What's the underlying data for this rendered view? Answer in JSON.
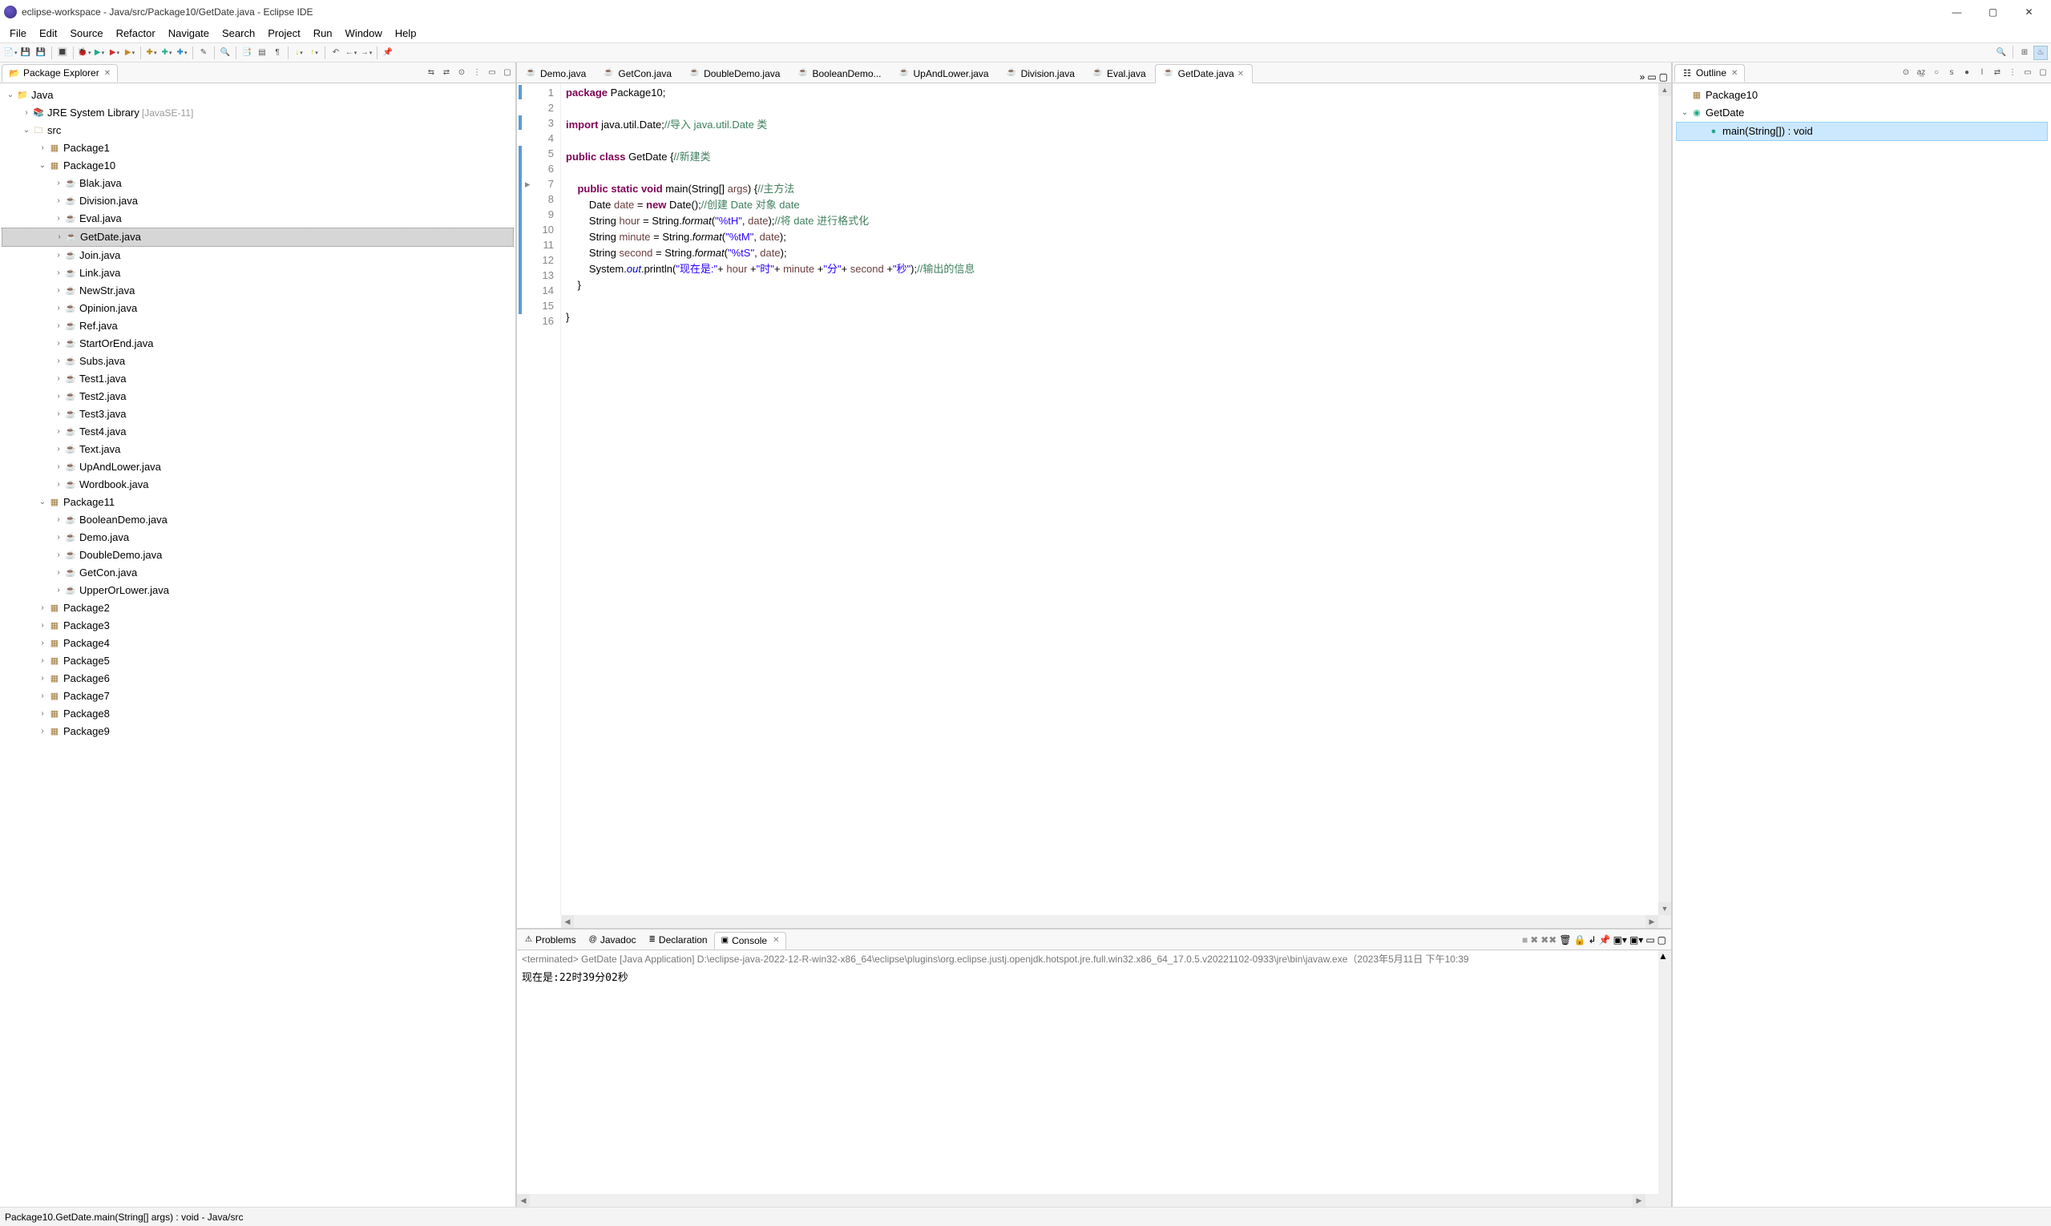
{
  "window_title": "eclipse-workspace - Java/src/Package10/GetDate.java - Eclipse IDE",
  "menubar": [
    "File",
    "Edit",
    "Source",
    "Refactor",
    "Navigate",
    "Search",
    "Project",
    "Run",
    "Window",
    "Help"
  ],
  "left_view": {
    "title": "Package Explorer"
  },
  "project_name": "Java",
  "jre_label": "JRE System Library",
  "jre_decor": "[JavaSE-11]",
  "src_label": "src",
  "packages_simple": [
    "Package1"
  ],
  "pkg10_label": "Package10",
  "pkg10_files": [
    "Blak.java",
    "Division.java",
    "Eval.java",
    "GetDate.java",
    "Join.java",
    "Link.java",
    "NewStr.java",
    "Opinion.java",
    "Ref.java",
    "StartOrEnd.java",
    "Subs.java",
    "Test1.java",
    "Test2.java",
    "Test3.java",
    "Test4.java",
    "Text.java",
    "UpAndLower.java",
    "Wordbook.java"
  ],
  "pkg10_selected": "GetDate.java",
  "pkg11_label": "Package11",
  "pkg11_files": [
    "BooleanDemo.java",
    "Demo.java",
    "DoubleDemo.java",
    "GetCon.java",
    "UpperOrLower.java"
  ],
  "packages_rest": [
    "Package2",
    "Package3",
    "Package4",
    "Package5",
    "Package6",
    "Package7",
    "Package8",
    "Package9"
  ],
  "editor_tabs": [
    {
      "label": "Demo.java",
      "active": false
    },
    {
      "label": "GetCon.java",
      "active": false
    },
    {
      "label": "DoubleDemo.java",
      "active": false
    },
    {
      "label": "BooleanDemo...",
      "active": false
    },
    {
      "label": "UpAndLower.java",
      "active": false
    },
    {
      "label": "Division.java",
      "active": false
    },
    {
      "label": "Eval.java",
      "active": false
    },
    {
      "label": "GetDate.java",
      "active": true
    }
  ],
  "code_lines": {
    "l1": {
      "pre": "",
      "kw": "package",
      "rest": " Package10;"
    },
    "l3a": {
      "kw": "import",
      "rest": " java.util.Date;",
      "cm": "//导入 java.util.Date 类"
    },
    "l5a": {
      "kw1": "public",
      "kw2": "class",
      "name": " GetDate ",
      "brace": "{",
      "cm": "//新建类"
    },
    "l7a": {
      "indent": "    ",
      "kw1": "public",
      "kw2": "static",
      "kw3": "void",
      "name": " main",
      "paren": "(String[] ",
      "arg": "args",
      "pr2": ") {",
      "cm": "//主方法"
    },
    "l8a": {
      "indent": "        ",
      "t": "Date ",
      "hl": "date",
      "eq": " = ",
      "kw": "new",
      "rest": " Date();",
      "cm": "//创建 Date 对象 date"
    },
    "l9a": {
      "indent": "        ",
      "t": "String ",
      "hl": "hour",
      "eq": " = String.",
      "it": "format",
      "p": "(",
      "s": "\"%tH\"",
      "c": ", ",
      "hl2": "date",
      "r": ");",
      "cm": "//将 date 进行格式化"
    },
    "l10a": {
      "indent": "        ",
      "t": "String ",
      "hl": "minute",
      "eq": " = String.",
      "it": "format",
      "p": "(",
      "s": "\"%tM\"",
      "c": ", ",
      "hl2": "date",
      "r": ");"
    },
    "l11a": {
      "indent": "        ",
      "t": "String ",
      "hl": "second",
      "eq": " = String.",
      "it": "format",
      "p": "(",
      "s": "\"%tS\"",
      "c": ", ",
      "hl2": "date",
      "r": ");"
    },
    "l12a": {
      "indent": "        ",
      "sys": "System.",
      "out": "out",
      "pl": ".println(",
      "s1": "\"现在是:\"",
      "p1": "+ ",
      "h1": "hour",
      "p2": " +",
      "s2": "\"时\"",
      "p3": "+ ",
      "h2": "minute",
      "p4": " +",
      "s3": "\"分\"",
      "p5": "+ ",
      "h3": "second",
      "p6": " +",
      "s4": "\"秒\"",
      "r": ");",
      "cm": "//输出的信息"
    },
    "l13": "    }",
    "l15": "}",
    "l16": ""
  },
  "gutter": [
    "1",
    "2",
    "3",
    "4",
    "5",
    "6",
    "7",
    "8",
    "9",
    "10",
    "11",
    "12",
    "13",
    "14",
    "15",
    "16"
  ],
  "outline_view": {
    "title": "Outline"
  },
  "outline": {
    "pkg": "Package10",
    "cls": "GetDate",
    "method": "main(String[]) : void"
  },
  "bottom_tabs": [
    {
      "label": "Problems",
      "icon": "⚠"
    },
    {
      "label": "Javadoc",
      "icon": "@"
    },
    {
      "label": "Declaration",
      "icon": "≣"
    },
    {
      "label": "Console",
      "icon": "▣",
      "active": true
    }
  ],
  "console_header": "<terminated> GetDate [Java Application] D:\\eclipse-java-2022-12-R-win32-x86_64\\eclipse\\plugins\\org.eclipse.justj.openjdk.hotspot.jre.full.win32.x86_64_17.0.5.v20221102-0933\\jre\\bin\\javaw.exe（2023年5月11日 下午10:39",
  "console_output": "现在是:22时39分02秒",
  "status": "Package10.GetDate.main(String[] args) : void - Java/src"
}
